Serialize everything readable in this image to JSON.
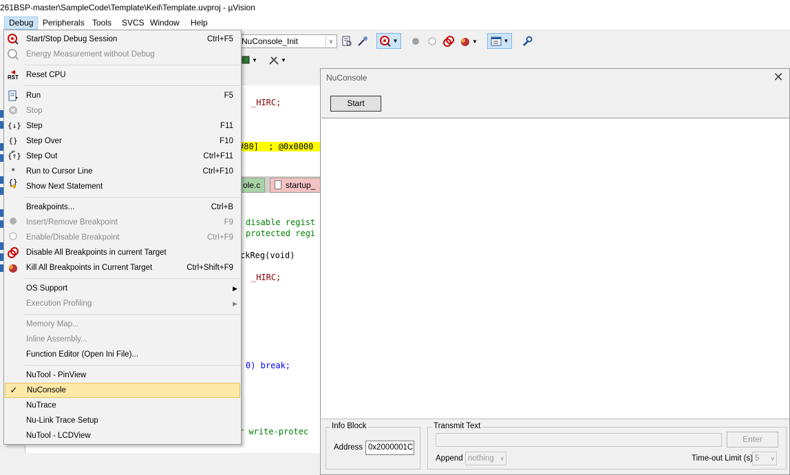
{
  "window": {
    "title": "261BSP-master\\SampleCode\\Template\\Keil\\Template.uvproj - µVision"
  },
  "menubar": {
    "items": [
      "Debug",
      "Peripherals",
      "Tools",
      "SVCS",
      "Window",
      "Help"
    ]
  },
  "toolbar": {
    "function_combo": "NuConsole_Init"
  },
  "editor": {
    "lines": [
      "_HIRC;",
      "#80]  ; @0x0000",
      "disable regist",
      "protected regi",
      "ckReg(void)",
      "_HIRC;",
      "0) break;",
      "r write-protec"
    ],
    "tabs": [
      "ole.c",
      "startup_"
    ]
  },
  "debug_menu": {
    "items": [
      {
        "label": "Start/Stop Debug Session",
        "shortcut": "Ctrl+F5",
        "icon": "debug-session-icon",
        "disabled": false
      },
      {
        "label": "Energy Measurement without Debug",
        "shortcut": "",
        "icon": "energy-icon",
        "disabled": true
      },
      {
        "label": "Reset CPU",
        "shortcut": "",
        "icon": "reset-cpu-icon",
        "disabled": false
      },
      {
        "label": "Run",
        "shortcut": "F5",
        "icon": "run-icon",
        "disabled": false
      },
      {
        "label": "Stop",
        "shortcut": "",
        "icon": "stop-icon",
        "disabled": true
      },
      {
        "label": "Step",
        "shortcut": "F11",
        "icon": "step-icon",
        "disabled": false
      },
      {
        "label": "Step Over",
        "shortcut": "F10",
        "icon": "step-over-icon",
        "disabled": false
      },
      {
        "label": "Step Out",
        "shortcut": "Ctrl+F11",
        "icon": "step-out-icon",
        "disabled": false
      },
      {
        "label": "Run to Cursor Line",
        "shortcut": "Ctrl+F10",
        "icon": "run-to-cursor-icon",
        "disabled": false
      },
      {
        "label": "Show Next Statement",
        "shortcut": "",
        "icon": "arrow-right-icon",
        "disabled": false
      },
      {
        "label": "Breakpoints...",
        "shortcut": "Ctrl+B",
        "icon": "",
        "disabled": false
      },
      {
        "label": "Insert/Remove Breakpoint",
        "shortcut": "F9",
        "icon": "breakpoint-icon",
        "disabled": true
      },
      {
        "label": "Enable/Disable Breakpoint",
        "shortcut": "Ctrl+F9",
        "icon": "breakpoint-outline-icon",
        "disabled": true
      },
      {
        "label": "Disable All Breakpoints in current Target",
        "shortcut": "",
        "icon": "disable-breakpoints-icon",
        "disabled": false
      },
      {
        "label": "Kill All Breakpoints in Current Target",
        "shortcut": "Ctrl+Shift+F9",
        "icon": "kill-breakpoints-icon",
        "disabled": false
      },
      {
        "label": "OS Support",
        "shortcut": "",
        "icon": "",
        "disabled": false
      },
      {
        "label": "Execution Profiling",
        "shortcut": "",
        "icon": "",
        "disabled": true
      },
      {
        "label": "Memory Map...",
        "shortcut": "",
        "icon": "",
        "disabled": true
      },
      {
        "label": "Inline Assembly...",
        "shortcut": "",
        "icon": "",
        "disabled": true
      },
      {
        "label": "Function Editor (Open Ini File)...",
        "shortcut": "",
        "icon": "",
        "disabled": false
      },
      {
        "label": "NuTool - PinView",
        "shortcut": "",
        "icon": "",
        "disabled": false
      },
      {
        "label": "NuConsole",
        "shortcut": "",
        "icon": "check-icon",
        "disabled": false
      },
      {
        "label": "NuTrace",
        "shortcut": "",
        "icon": "",
        "disabled": false
      },
      {
        "label": "Nu-Link Trace Setup",
        "shortcut": "",
        "icon": "",
        "disabled": false
      },
      {
        "label": "NuTool - LCDView",
        "shortcut": "",
        "icon": "",
        "disabled": false
      }
    ]
  },
  "nuconsole": {
    "title": "NuConsole",
    "start_label": "Start",
    "info_block_label": "Info Block",
    "address_label": "Address",
    "address_value": "0x2000001C",
    "transmit_label": "Transmit Text",
    "transmit_value": "",
    "enter_label": "Enter",
    "append_label": "Append",
    "append_value": "nothing",
    "timeout_label": "Time-out Limit (s)",
    "timeout_value": "5"
  },
  "colors": {
    "menu_active_bg": "#cce4f7",
    "checked_item_bg": "#fde9a8",
    "highlight_line": "#ffff00",
    "keyword_blue": "#0000ff",
    "comment_green": "#008000",
    "macro_red": "#8b0000"
  }
}
